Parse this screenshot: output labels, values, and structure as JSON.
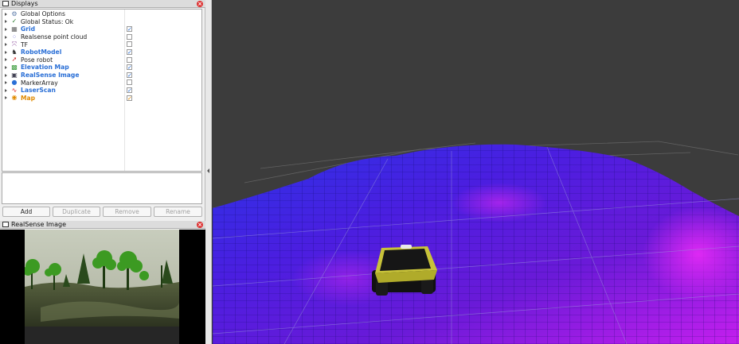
{
  "displays_panel": {
    "title": "Displays",
    "items": [
      {
        "label": "Global Options",
        "icon": "gear-icon",
        "style": "normal",
        "checkbox": null
      },
      {
        "label": "Global Status: Ok",
        "icon": "checkmark-icon",
        "style": "normal",
        "checkbox": null
      },
      {
        "label": "Grid",
        "icon": "grid-icon",
        "style": "blue",
        "checkbox": true
      },
      {
        "label": "Realsense point cloud",
        "icon": "point-cloud-icon",
        "style": "normal",
        "checkbox": false
      },
      {
        "label": "TF",
        "icon": "tf-axes-icon",
        "style": "normal",
        "checkbox": false
      },
      {
        "label": "RobotModel",
        "icon": "robot-model-icon",
        "style": "blue",
        "checkbox": true
      },
      {
        "label": "Pose robot",
        "icon": "pose-arrow-icon",
        "style": "normal",
        "checkbox": false
      },
      {
        "label": "Elevation Map",
        "icon": "elevation-map-icon",
        "style": "blue",
        "checkbox": true
      },
      {
        "label": "RealSense Image",
        "icon": "image-icon",
        "style": "blue",
        "checkbox": true
      },
      {
        "label": "MarkerArray",
        "icon": "marker-array-icon",
        "style": "normal",
        "checkbox": false
      },
      {
        "label": "LaserScan",
        "icon": "laser-scan-icon",
        "style": "blue",
        "checkbox": true
      },
      {
        "label": "Map",
        "icon": "map-icon",
        "style": "orange",
        "checkbox": true
      }
    ],
    "buttons": {
      "add": "Add",
      "duplicate": "Duplicate",
      "remove": "Remove",
      "rename": "Rename"
    }
  },
  "image_panel": {
    "title": "RealSense Image"
  },
  "colors": {
    "link_blue": "#2a6fd6",
    "warning_orange": "#e08a00",
    "viewport_background": "#3c3c3c",
    "elevation_low": "#1a0fd8",
    "elevation_high": "#d21cf0"
  }
}
